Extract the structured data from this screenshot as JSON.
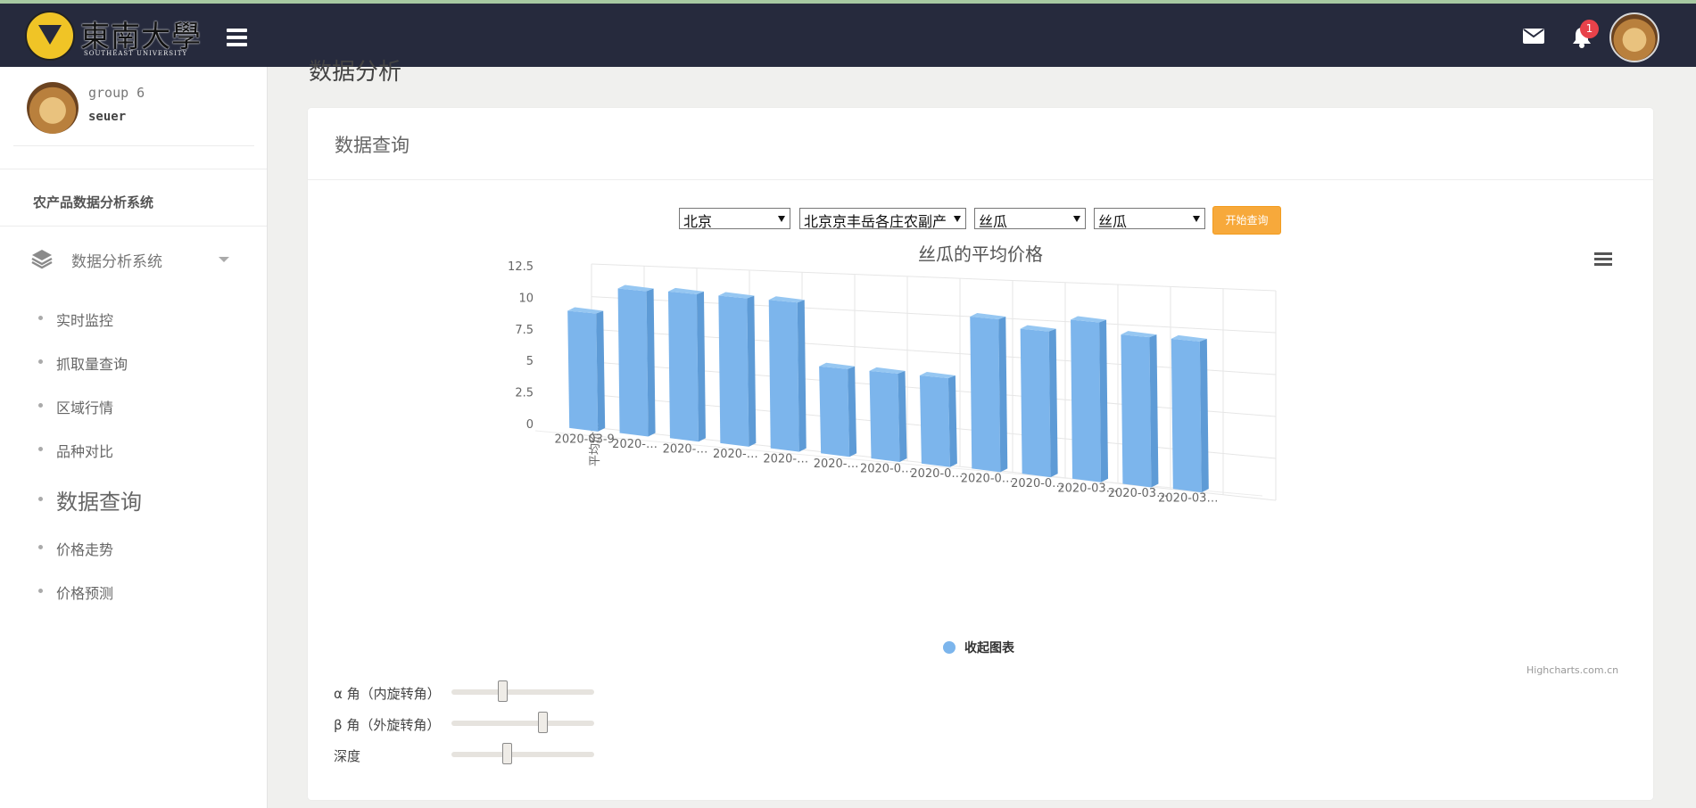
{
  "topbar": {
    "logo_text": "東南大學",
    "logo_sub": "SOUTHEAST UNIVERSITY",
    "notification_count": "1",
    "icons": [
      "hamburger-icon",
      "mail-icon",
      "bell-icon"
    ]
  },
  "sidebar": {
    "user_group": "group 6",
    "user_name": "seuer",
    "system_title": "农产品数据分析系统",
    "menu_label": "数据分析系统",
    "items": [
      {
        "label": "实时监控",
        "active": false
      },
      {
        "label": "抓取量查询",
        "active": false
      },
      {
        "label": "区域行情",
        "active": false
      },
      {
        "label": "品种对比",
        "active": false
      },
      {
        "label": "数据查询",
        "active": true
      },
      {
        "label": "价格走势",
        "active": false
      },
      {
        "label": "价格预测",
        "active": false
      }
    ]
  },
  "page": {
    "heading": "数据分析",
    "card_title": "数据查询"
  },
  "filters": {
    "region": "北京",
    "market": "北京京丰岳各庄农副产",
    "category": "丝瓜",
    "variety": "丝瓜",
    "query_button": "开始查询"
  },
  "chart_data": {
    "type": "bar",
    "title": "丝瓜的平均价格",
    "ylabel": "平均价格",
    "ylim": [
      0,
      12.5
    ],
    "yticks": [
      "0",
      "2.5",
      "5",
      "7.5",
      "10",
      "12.5"
    ],
    "tick_labels": [
      "2020-03-9",
      "2020-…",
      "2020-…",
      "2020-…",
      "2020-…",
      "2020-…",
      "2020-0…",
      "2020-0…",
      "2020-0…",
      "2020-0…",
      "2020-03…",
      "2020-03…",
      "2020-03…"
    ],
    "series": [
      {
        "name": "收起图表",
        "values": [
          9.3,
          11.4,
          11.5,
          11.5,
          11.5,
          6.7,
          6.7,
          6.7,
          11.5,
          10.9,
          11.9,
          11.1,
          11.1
        ]
      }
    ],
    "legend_position": "bottom",
    "colors": {
      "bar": "#7cb5ec",
      "bar_side": "#5e9bd6",
      "bar_top": "#96c7f2"
    },
    "grid": true,
    "credit": "Highcharts.com.cn"
  },
  "controls": {
    "alpha_label": "α 角（内旋转角）",
    "beta_label": "β 角（外旋转角）",
    "depth_label": "深度",
    "alpha_value": 0.35,
    "beta_value": 0.65,
    "depth_value": 0.38
  }
}
